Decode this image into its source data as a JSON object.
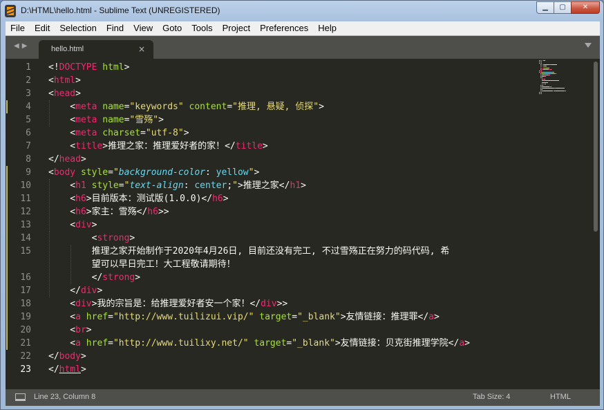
{
  "window": {
    "title": "D:\\HTML\\hello.html - Sublime Text (UNREGISTERED)",
    "controls": {
      "minimize": "▁",
      "maximize": "▢",
      "close": "✕"
    }
  },
  "menu": [
    "File",
    "Edit",
    "Selection",
    "Find",
    "View",
    "Goto",
    "Tools",
    "Project",
    "Preferences",
    "Help"
  ],
  "tabs": [
    {
      "label": "hello.html",
      "close": "×",
      "active": true
    }
  ],
  "nav": {
    "back_forward": "◀▶"
  },
  "editor": {
    "current_line": 23,
    "lines": [
      {
        "num": "1",
        "tokens": [
          [
            "t-plain",
            "<!"
          ],
          [
            "t-tag",
            "DOCTYPE"
          ],
          [
            "t-plain",
            " "
          ],
          [
            "t-attr",
            "html"
          ],
          [
            "t-plain",
            ">"
          ]
        ]
      },
      {
        "num": "2",
        "tokens": [
          [
            "t-plain",
            "<"
          ],
          [
            "t-tag",
            "html"
          ],
          [
            "t-plain",
            ">"
          ]
        ]
      },
      {
        "num": "3",
        "tokens": [
          [
            "t-plain",
            "<"
          ],
          [
            "t-tag",
            "head"
          ],
          [
            "t-plain",
            ">"
          ]
        ]
      },
      {
        "num": "4",
        "tokens": [
          [
            "t-plain",
            "    <"
          ],
          [
            "t-tag",
            "meta"
          ],
          [
            "t-plain",
            " "
          ],
          [
            "t-attr",
            "name"
          ],
          [
            "t-plain",
            "="
          ],
          [
            "t-str",
            "\"keywords\""
          ],
          [
            "t-plain",
            " "
          ],
          [
            "t-attr",
            "content"
          ],
          [
            "t-plain",
            "="
          ],
          [
            "t-str",
            "\"推理, 悬疑, 侦探\""
          ],
          [
            "t-plain",
            ">"
          ]
        ]
      },
      {
        "num": "5",
        "tokens": [
          [
            "t-plain",
            "    <"
          ],
          [
            "t-tag",
            "meta"
          ],
          [
            "t-plain",
            " "
          ],
          [
            "t-attr",
            "name"
          ],
          [
            "t-plain",
            "="
          ],
          [
            "t-str",
            "\"雪殇\""
          ],
          [
            "t-plain",
            ">"
          ]
        ]
      },
      {
        "num": "6",
        "tokens": [
          [
            "t-plain",
            "    <"
          ],
          [
            "t-tag",
            "meta"
          ],
          [
            "t-plain",
            " "
          ],
          [
            "t-attr",
            "charset"
          ],
          [
            "t-plain",
            "="
          ],
          [
            "t-str",
            "\"utf-8\""
          ],
          [
            "t-plain",
            ">"
          ]
        ]
      },
      {
        "num": "7",
        "tokens": [
          [
            "t-plain",
            "    <"
          ],
          [
            "t-tag",
            "title"
          ],
          [
            "t-plain",
            ">推理之家：推理爱好者的家！</"
          ],
          [
            "t-tag",
            "title"
          ],
          [
            "t-plain",
            ">"
          ]
        ]
      },
      {
        "num": "8",
        "tokens": [
          [
            "t-plain",
            "</"
          ],
          [
            "t-tag",
            "head"
          ],
          [
            "t-plain",
            ">"
          ]
        ]
      },
      {
        "num": "9",
        "tokens": [
          [
            "t-plain",
            "<"
          ],
          [
            "t-tag",
            "body"
          ],
          [
            "t-plain",
            " "
          ],
          [
            "t-attr",
            "style"
          ],
          [
            "t-plain",
            "="
          ],
          [
            "t-str",
            "\""
          ],
          [
            "t-prop",
            "background-color"
          ],
          [
            "t-plain",
            ": "
          ],
          [
            "t-val",
            "yellow"
          ],
          [
            "t-str",
            "\""
          ],
          [
            "t-plain",
            ">"
          ]
        ]
      },
      {
        "num": "10",
        "tokens": [
          [
            "t-plain",
            "    <"
          ],
          [
            "t-tag",
            "h1"
          ],
          [
            "t-plain",
            " "
          ],
          [
            "t-attr",
            "style"
          ],
          [
            "t-plain",
            "="
          ],
          [
            "t-str",
            "\""
          ],
          [
            "t-prop",
            "text-align"
          ],
          [
            "t-plain",
            ": "
          ],
          [
            "t-val",
            "center"
          ],
          [
            "t-plain",
            ";"
          ],
          [
            "t-str",
            "\""
          ],
          [
            "t-plain",
            ">推理之家</"
          ],
          [
            "t-tag",
            "h1"
          ],
          [
            "t-plain",
            ">"
          ]
        ]
      },
      {
        "num": "11",
        "tokens": [
          [
            "t-plain",
            "    <"
          ],
          [
            "t-tag",
            "h6"
          ],
          [
            "t-plain",
            ">目前版本：测试版(1.0.0)</"
          ],
          [
            "t-tag",
            "h6"
          ],
          [
            "t-plain",
            ">"
          ]
        ]
      },
      {
        "num": "12",
        "tokens": [
          [
            "t-plain",
            "    <"
          ],
          [
            "t-tag",
            "h6"
          ],
          [
            "t-plain",
            ">家主：雪殇</"
          ],
          [
            "t-tag",
            "h6"
          ],
          [
            "t-plain",
            ">>"
          ]
        ]
      },
      {
        "num": "13",
        "tokens": [
          [
            "t-plain",
            "    <"
          ],
          [
            "t-tag",
            "div"
          ],
          [
            "t-plain",
            ">"
          ]
        ]
      },
      {
        "num": "14",
        "tokens": [
          [
            "t-plain",
            "        <"
          ],
          [
            "t-tag",
            "strong"
          ],
          [
            "t-plain",
            ">"
          ]
        ]
      },
      {
        "num": "15",
        "tokens": [
          [
            "t-plain",
            "        推理之家开始制作于2020年4月26日, 目前还没有完工, 不过雪殇正在努力的码代码, 希"
          ]
        ]
      },
      {
        "num": "",
        "tokens": [
          [
            "t-plain",
            "        望可以早日完工！大工程敬请期待！"
          ]
        ]
      },
      {
        "num": "16",
        "tokens": [
          [
            "t-plain",
            "        </"
          ],
          [
            "t-tag",
            "strong"
          ],
          [
            "t-plain",
            ">"
          ]
        ]
      },
      {
        "num": "17",
        "tokens": [
          [
            "t-plain",
            "    </"
          ],
          [
            "t-tag",
            "div"
          ],
          [
            "t-plain",
            ">"
          ]
        ]
      },
      {
        "num": "18",
        "tokens": [
          [
            "t-plain",
            "    <"
          ],
          [
            "t-tag",
            "div"
          ],
          [
            "t-plain",
            ">我的宗旨是：给推理爱好者安一个家！</"
          ],
          [
            "t-tag",
            "div"
          ],
          [
            "t-plain",
            ">>"
          ]
        ]
      },
      {
        "num": "19",
        "tokens": [
          [
            "t-plain",
            "    <"
          ],
          [
            "t-tag",
            "a"
          ],
          [
            "t-plain",
            " "
          ],
          [
            "t-attr",
            "href"
          ],
          [
            "t-plain",
            "="
          ],
          [
            "t-str",
            "\"http://www.tuilizui.vip/\""
          ],
          [
            "t-plain",
            " "
          ],
          [
            "t-attr",
            "target"
          ],
          [
            "t-plain",
            "="
          ],
          [
            "t-str",
            "\"_blank\""
          ],
          [
            "t-plain",
            ">友情链接：推理罪</"
          ],
          [
            "t-tag",
            "a"
          ],
          [
            "t-plain",
            ">"
          ]
        ]
      },
      {
        "num": "20",
        "tokens": [
          [
            "t-plain",
            "    <"
          ],
          [
            "t-tag",
            "br"
          ],
          [
            "t-plain",
            ">"
          ]
        ]
      },
      {
        "num": "21",
        "tokens": [
          [
            "t-plain",
            "    <"
          ],
          [
            "t-tag",
            "a"
          ],
          [
            "t-plain",
            " "
          ],
          [
            "t-attr",
            "href"
          ],
          [
            "t-plain",
            "="
          ],
          [
            "t-str",
            "\"http://www.tuilixy.net/\""
          ],
          [
            "t-plain",
            " "
          ],
          [
            "t-attr",
            "target"
          ],
          [
            "t-plain",
            "="
          ],
          [
            "t-str",
            "\"_blank\""
          ],
          [
            "t-plain",
            ">友情链接：贝克街推理学院</"
          ],
          [
            "t-tag",
            "a"
          ],
          [
            "t-plain",
            ">"
          ]
        ]
      },
      {
        "num": "22",
        "tokens": [
          [
            "t-plain",
            "</"
          ],
          [
            "t-tag",
            "body"
          ],
          [
            "t-plain",
            ">"
          ]
        ]
      },
      {
        "num": "23",
        "tokens": [
          [
            "t-plain",
            "</"
          ],
          [
            "t-tag",
            "html"
          ],
          [
            "t-plain",
            ">"
          ]
        ]
      }
    ]
  },
  "status": {
    "position": "Line 23, Column 8",
    "tab_size": "Tab Size: 4",
    "syntax": "HTML"
  },
  "colors": {
    "editor_bg": "#272822",
    "tag": "#f92672",
    "attr": "#a6e22e",
    "string": "#e6db74",
    "keyword": "#66d9ef",
    "text": "#f8f8f2",
    "gutter": "#90908a"
  }
}
